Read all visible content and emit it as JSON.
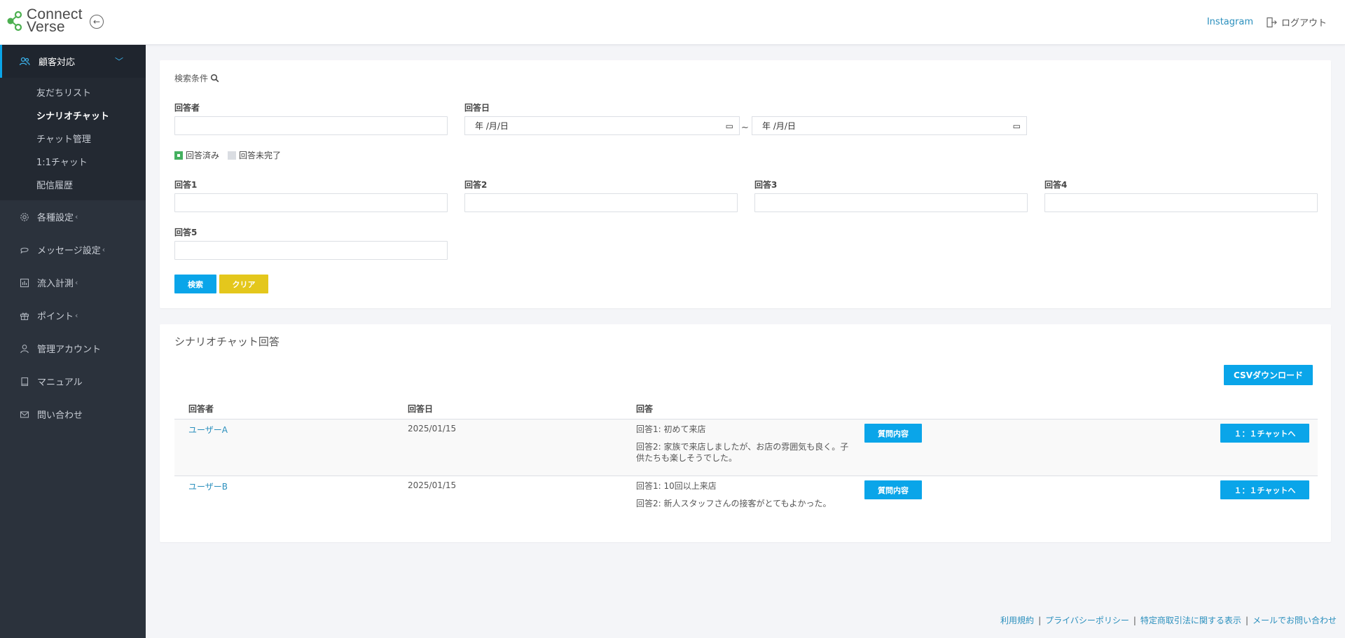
{
  "app": {
    "logo_line1": "Connect",
    "logo_line2": "Verse"
  },
  "header": {
    "instagram": "Instagram",
    "logout": "ログアウト"
  },
  "sidebar": {
    "active_section": "顧客対応",
    "sub_items": [
      {
        "label": "友だちリスト",
        "current": false
      },
      {
        "label": "シナリオチャット",
        "current": true
      },
      {
        "label": "チャット管理",
        "current": false
      },
      {
        "label": "1:1チャット",
        "current": false
      },
      {
        "label": "配信履歴",
        "current": false
      }
    ],
    "items": [
      {
        "label": "各種設定",
        "icon": "gear-icon",
        "has_chevron": true
      },
      {
        "label": "メッセージ設定",
        "icon": "chat-bubble-icon",
        "has_chevron": true
      },
      {
        "label": "流入計測",
        "icon": "bar-chart-icon",
        "has_chevron": true
      },
      {
        "label": "ポイント",
        "icon": "gift-icon",
        "has_chevron": true
      },
      {
        "label": "管理アカウント",
        "icon": "user-icon",
        "has_chevron": false
      },
      {
        "label": "マニュアル",
        "icon": "book-icon",
        "has_chevron": false
      },
      {
        "label": "問い合わせ",
        "icon": "mail-icon",
        "has_chevron": false
      }
    ],
    "chevron": "‹"
  },
  "search": {
    "title": "検索条件",
    "respondent_label": "回答者",
    "respondent_value": "",
    "date_label": "回答日",
    "date_from_placeholder": "年 /月/日",
    "date_to_placeholder": "年 /月/日",
    "tilde": "~",
    "answered_label": "回答済み",
    "unanswered_label": "回答未完了",
    "answer_labels": [
      "回答1",
      "回答2",
      "回答3",
      "回答4",
      "回答5"
    ],
    "search_button": "検索",
    "clear_button": "クリア"
  },
  "results": {
    "title": "シナリオチャット回答",
    "csv_button": "CSVダウンロード",
    "columns": [
      "回答者",
      "回答日",
      "回答"
    ],
    "question_button": "質問内容",
    "chat_button": "１：１チャットへ",
    "rows": [
      {
        "user": "ユーザーA",
        "date": "2025/01/15",
        "answers": [
          "回答1: 初めて来店",
          "回答2: 家族で来店しましたが、お店の雰囲気も良く。子供たちも楽しそうでした。"
        ]
      },
      {
        "user": "ユーザーB",
        "date": "2025/01/15",
        "answers": [
          "回答1: 10回以上来店",
          "回答2: 新人スタッフさんの接客がとてもよかった。"
        ]
      }
    ]
  },
  "footer": {
    "links": [
      "利用規約",
      "プライバシーポリシー",
      "特定商取引法に関する表示",
      "メールでお問い合わせ"
    ],
    "separator": "|"
  },
  "colors": {
    "accent": "#0aa5e9",
    "clear": "#e4c71c",
    "sidebar": "#2b323c",
    "answered": "#44b05f",
    "link": "#2a8fbd"
  }
}
